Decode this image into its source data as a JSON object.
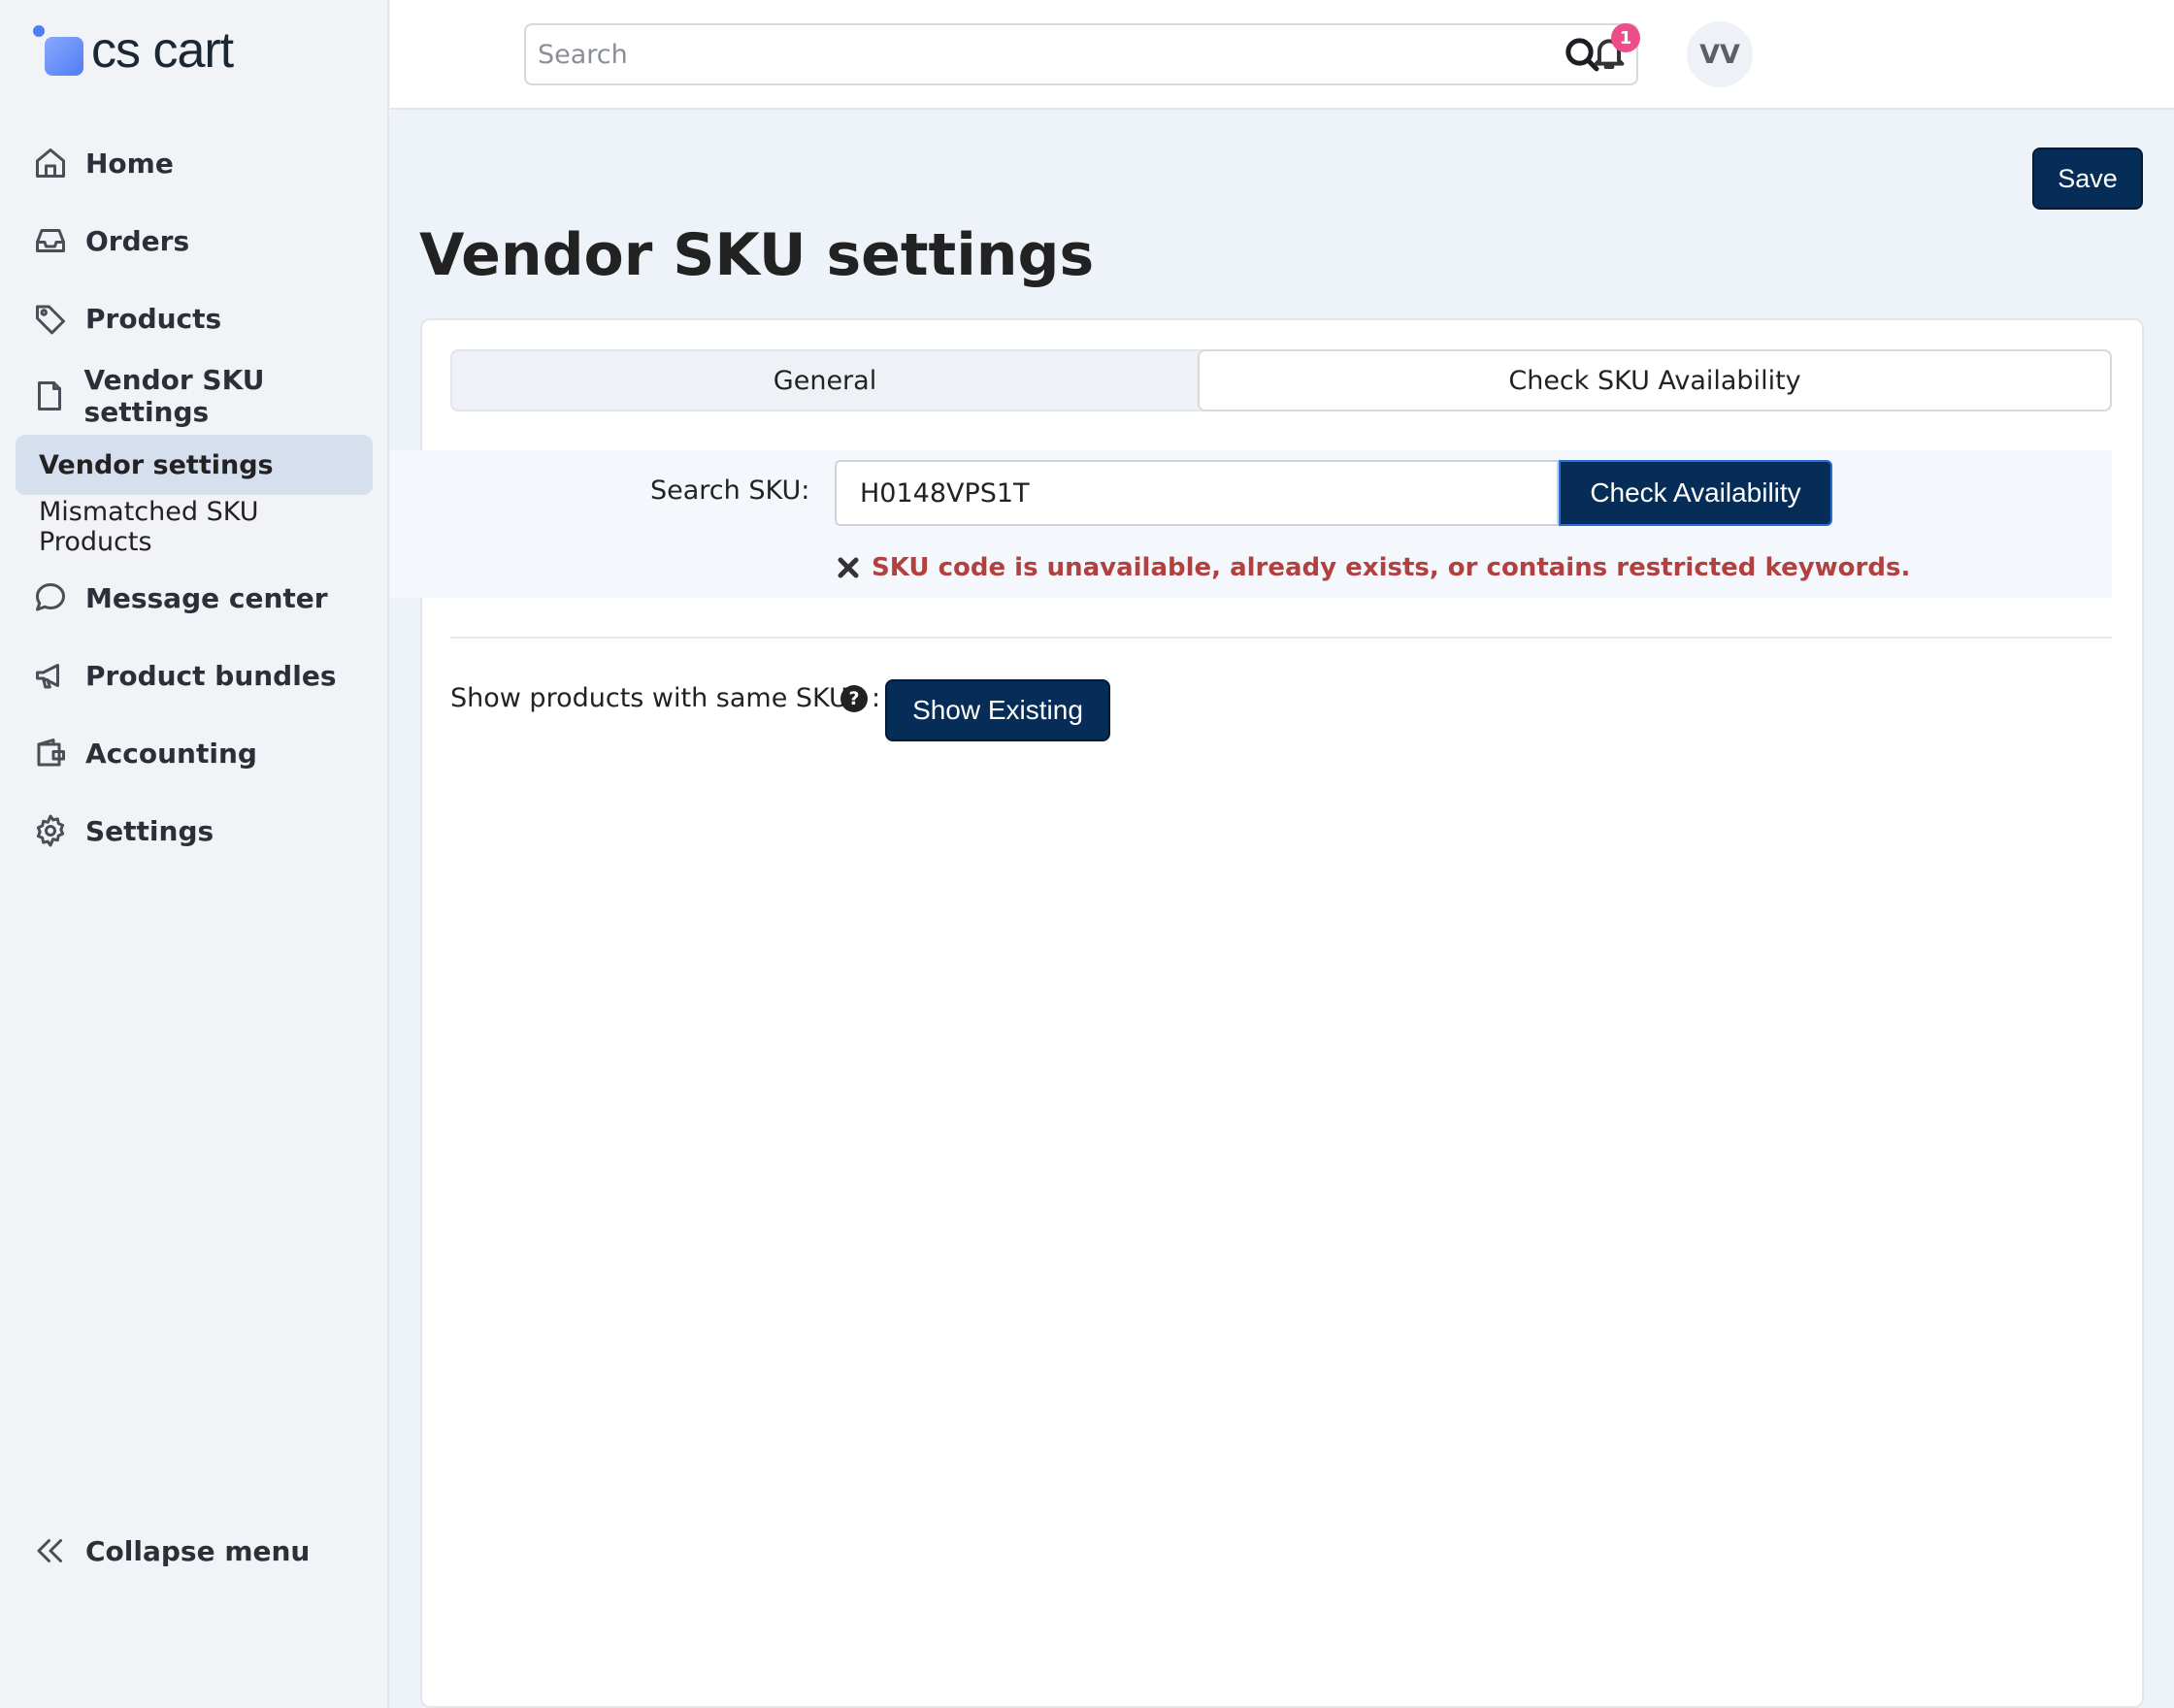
{
  "logo": {
    "text": "cs cart"
  },
  "sidebar": {
    "items": [
      {
        "label": "Home",
        "icon": "home-icon"
      },
      {
        "label": "Orders",
        "icon": "inbox-icon"
      },
      {
        "label": "Products",
        "icon": "tag-icon"
      },
      {
        "label": "Vendor SKU settings",
        "icon": "file-icon"
      },
      {
        "label": "Message center",
        "icon": "chat-icon"
      },
      {
        "label": "Product bundles",
        "icon": "megaphone-icon"
      },
      {
        "label": "Accounting",
        "icon": "wallet-icon"
      },
      {
        "label": "Settings",
        "icon": "gear-icon"
      }
    ],
    "subitems": [
      {
        "label": "Vendor settings",
        "active": true
      },
      {
        "label": "Mismatched SKU Products",
        "active": false
      }
    ],
    "collapse_label": "Collapse menu"
  },
  "header": {
    "search_placeholder": "Search",
    "notification_count": "1",
    "avatar_initials": "VV"
  },
  "main": {
    "save_label": "Save",
    "page_title": "Vendor SKU settings",
    "tabs": [
      {
        "label": "General",
        "active": false
      },
      {
        "label": "Check SKU Availability",
        "active": true
      }
    ],
    "sku_search": {
      "label": "Search SKU:",
      "value": "H0148VPS1T",
      "button_label": "Check Availability",
      "error_message": "SKU code is unavailable, already exists, or contains restricted keywords."
    },
    "same_sku": {
      "label": "Show products with same SKU",
      "colon": ":",
      "help_glyph": "?",
      "button_label": "Show Existing"
    }
  },
  "colors": {
    "primary": "#062d57",
    "error": "#b2403f",
    "badge": "#ee4d8a",
    "active_nav_bg": "#d5dfee"
  }
}
